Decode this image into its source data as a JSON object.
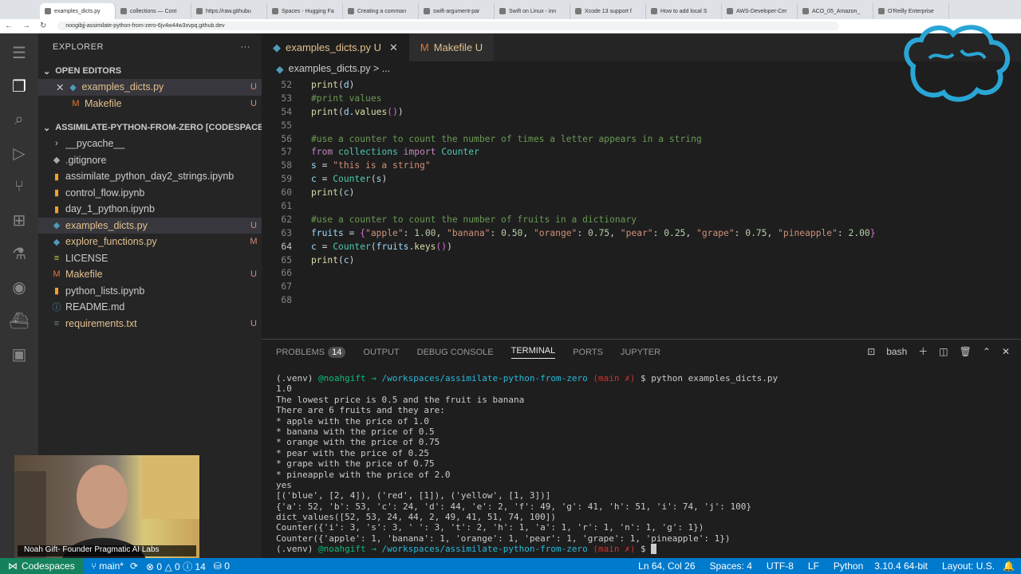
{
  "browser": {
    "tabs": [
      "examples_dicts.py",
      "collections — Cont",
      "https://raw.githubu",
      "Spaces - Hugging Fa",
      "Creating a comman",
      "swift-argument-par",
      "Swift on Linux - inn",
      "Xcode 13 support f",
      "How to add local S",
      "AWS-Developer-Cer",
      "ACO_05_Amazon_",
      "O'Reilly Enterprise"
    ],
    "url": "noogibjj-assimilate-python-from-zero-6jv4w44w3xvpq.github.dev"
  },
  "sidebar": {
    "title": "EXPLORER",
    "more": "···",
    "open_editors": "OPEN EDITORS",
    "open_files": [
      {
        "name": "examples_dicts.py",
        "status": "U",
        "icon": "python-icon"
      },
      {
        "name": "Makefile",
        "status": "U",
        "icon": "makefile-icon"
      }
    ],
    "workspace": "ASSIMILATE-PYTHON-FROM-ZERO [CODESPACES]",
    "files": [
      {
        "name": "__pycache__",
        "status": "",
        "icon": "folder-icon"
      },
      {
        "name": ".gitignore",
        "status": "",
        "icon": "git-icon"
      },
      {
        "name": "assimilate_python_day2_strings.ipynb",
        "status": "",
        "icon": "notebook-icon"
      },
      {
        "name": "control_flow.ipynb",
        "status": "",
        "icon": "notebook-icon"
      },
      {
        "name": "day_1_python.ipynb",
        "status": "",
        "icon": "notebook-icon"
      },
      {
        "name": "examples_dicts.py",
        "status": "U",
        "icon": "python-icon"
      },
      {
        "name": "explore_functions.py",
        "status": "M",
        "icon": "python-icon"
      },
      {
        "name": "LICENSE",
        "status": "",
        "icon": "license-icon"
      },
      {
        "name": "Makefile",
        "status": "U",
        "icon": "makefile-icon"
      },
      {
        "name": "python_lists.ipynb",
        "status": "",
        "icon": "notebook-icon"
      },
      {
        "name": "README.md",
        "status": "",
        "icon": "info-icon"
      },
      {
        "name": "requirements.txt",
        "status": "U",
        "icon": "text-file-icon"
      }
    ]
  },
  "editor": {
    "tabs": [
      {
        "name": "examples_dicts.py",
        "status": "U"
      },
      {
        "name": "Makefile",
        "status": "U"
      }
    ],
    "breadcrumb": "examples_dicts.py > ...",
    "lines": [
      "52",
      "53",
      "54",
      "55",
      "56",
      "57",
      "58",
      "59",
      "60",
      "61",
      "62",
      "63",
      "64",
      "65",
      "66",
      "67",
      "68"
    ]
  },
  "panel": {
    "tabs": [
      "PROBLEMS",
      "OUTPUT",
      "DEBUG CONSOLE",
      "TERMINAL",
      "PORTS",
      "JUPYTER"
    ],
    "problems_count": "14",
    "shell": "bash"
  },
  "terminal": {
    "prompt_env": "(.venv)",
    "prompt_user": "@noahgift",
    "prompt_arrow": "→",
    "prompt_path": "/workspaces/assimilate-python-from-zero",
    "prompt_branch": "(main ✗)",
    "prompt_symbol": "$",
    "command": "python examples_dicts.py",
    "output": [
      "1.0",
      "The lowest price is 0.5 and the fruit is banana",
      "There are 6 fruits and they are:",
      "* apple with the price of 1.0",
      "* banana with the price of 0.5",
      "* orange with the price of 0.75",
      "* pear with the price of 0.25",
      "* grape with the price of 0.75",
      "* pineapple with the price of 2.0",
      "yes",
      "[('blue', [2, 4]), ('red', [1]), ('yellow', [1, 3])]",
      "{'a': 52, 'b': 53, 'c': 24, 'd': 44, 'e': 2, 'f': 49, 'g': 41, 'h': 51, 'i': 74, 'j': 100}",
      "dict_values([52, 53, 24, 44, 2, 49, 41, 51, 74, 100])",
      "Counter({'i': 3, 's': 3, ' ': 3, 't': 2, 'h': 1, 'a': 1, 'r': 1, 'n': 1, 'g': 1})",
      "Counter({'apple': 1, 'banana': 1, 'orange': 1, 'pear': 1, 'grape': 1, 'pineapple': 1})"
    ]
  },
  "statusbar": {
    "codespaces": "Codespaces",
    "branch": "main*",
    "errors": "0",
    "warnings": "0",
    "info": "14",
    "ports": "0",
    "position": "Ln 64, Col 26",
    "spaces": "Spaces: 4",
    "encoding": "UTF-8",
    "eol": "LF",
    "language": "Python",
    "version": "3.10.4 64-bit",
    "layout": "Layout: U.S."
  },
  "webcam": {
    "caption": "Noah Gift- Founder Pragmatic AI Labs"
  },
  "colors": {
    "statusbar": "#007acc",
    "sidebar": "#252526",
    "editor": "#1e1e1e"
  }
}
